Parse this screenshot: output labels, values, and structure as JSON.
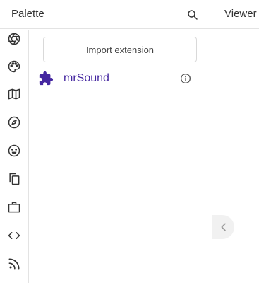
{
  "palette": {
    "title": "Palette",
    "search_icon": "search-icon",
    "import_button_label": "Import extension",
    "extensions": [
      {
        "name": "mrSound",
        "icon": "puzzle-piece-icon",
        "info_icon": "info-icon"
      }
    ]
  },
  "rail": {
    "icons": [
      "aperture-icon",
      "palette-icon",
      "map-icon",
      "compass-icon",
      "emoji-icon",
      "copy-icon",
      "briefcase-icon",
      "code-icon",
      "rss-icon"
    ]
  },
  "viewer": {
    "title": "Viewer"
  },
  "collapse_handle_icon": "chevron-left-icon",
  "colors": {
    "accent": "#4527a0",
    "border": "#e3e3e3",
    "icon": "#333333"
  }
}
